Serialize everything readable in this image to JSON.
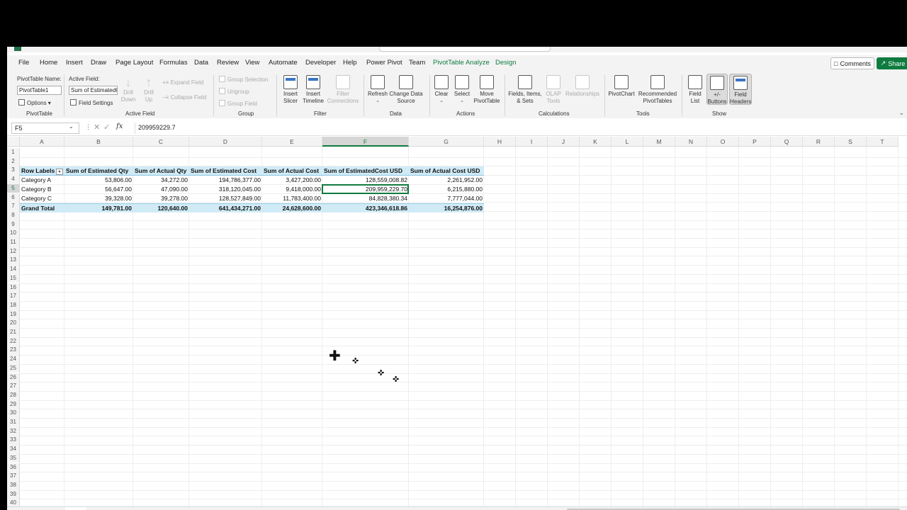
{
  "window": {
    "title_hint": ""
  },
  "tabs": [
    {
      "label": "File"
    },
    {
      "label": "Home"
    },
    {
      "label": "Insert"
    },
    {
      "label": "Draw"
    },
    {
      "label": "Page Layout"
    },
    {
      "label": "Formulas"
    },
    {
      "label": "Data"
    },
    {
      "label": "Review"
    },
    {
      "label": "View"
    },
    {
      "label": "Automate"
    },
    {
      "label": "Developer"
    },
    {
      "label": "Help"
    },
    {
      "label": "Power Pivot"
    },
    {
      "label": "Team"
    },
    {
      "label": "PivotTable Analyze"
    },
    {
      "label": "Design"
    }
  ],
  "active_tab": "PivotTable Analyze",
  "header_actions": {
    "comments": "Comments",
    "share": "Share"
  },
  "ribbon": {
    "pivottable": {
      "name_label": "PivotTable Name:",
      "name_value": "PivotTable1",
      "options": "Options",
      "group": "PivotTable"
    },
    "active_field": {
      "label": "Active Field:",
      "value": "Sum of EstimatedC",
      "field_settings": "Field Settings",
      "drill_down": "Drill Down",
      "drill_up": "Drill Up",
      "expand_field": "Expand Field",
      "collapse_field": "Collapse Field",
      "group": "Active Field"
    },
    "grouping": {
      "group_selection": "Group Selection",
      "ungroup": "Ungroup",
      "group_field": "Group Field",
      "group": "Group"
    },
    "filter": {
      "insert_slicer": "Insert Slicer",
      "insert_timeline": "Insert Timeline",
      "filter_connections": "Filter Connections",
      "group": "Filter"
    },
    "data": {
      "refresh": "Refresh",
      "change_source": "Change Data Source",
      "group": "Data"
    },
    "actions": {
      "clear": "Clear",
      "select": "Select",
      "move": "Move PivotTable",
      "group": "Actions"
    },
    "calculations": {
      "fields_items": "Fields, Items, & Sets",
      "olap": "OLAP Tools",
      "relationships": "Relationships",
      "group": "Calculations"
    },
    "tools": {
      "pivotchart": "PivotChart",
      "recommended": "Recommended PivotTables",
      "group": "Tools"
    },
    "show": {
      "field_list": "Field List",
      "buttons": "+/- Buttons",
      "field_headers": "Field Headers",
      "group": "Show"
    }
  },
  "formula_bar": {
    "name_box": "F5",
    "value": "209959229.7"
  },
  "columns": [
    "A",
    "B",
    "C",
    "D",
    "E",
    "F",
    "G",
    "H",
    "I",
    "J",
    "K",
    "L",
    "M",
    "N",
    "O",
    "P",
    "Q",
    "R",
    "S",
    "T"
  ],
  "rows": [
    "1",
    "2",
    "3",
    "4",
    "5",
    "6",
    "7",
    "8",
    "9",
    "10",
    "11",
    "12",
    "13",
    "14",
    "15",
    "16",
    "17",
    "18",
    "19",
    "20",
    "21",
    "22",
    "23",
    "24",
    "25",
    "26",
    "27",
    "28",
    "29",
    "30",
    "31",
    "32",
    "33",
    "34",
    "35",
    "36",
    "37",
    "38",
    "39",
    "40"
  ],
  "pivot": {
    "headers": [
      "Row Labels",
      "Sum of Estimated Qty",
      "Sum of Actual Qty",
      "Sum of Estimated Cost",
      "Sum of Actual Cost",
      "Sum of EstimatedCost USD",
      "Sum of Actual Cost USD"
    ],
    "rows": [
      [
        "Category A",
        "53,806.00",
        "34,272.00",
        "194,786,377.00",
        "3,427,200.00",
        "128,559,008.82",
        "2,261,952.00"
      ],
      [
        "Category B",
        "56,647.00",
        "47,090.00",
        "318,120,045.00",
        "9,418,000.00",
        "209,959,229.70",
        "6,215,880.00"
      ],
      [
        "Category C",
        "39,328.00",
        "39,278.00",
        "128,527,849.00",
        "11,783,400.00",
        "84,828,380.34",
        "7,777,044.00"
      ]
    ],
    "total": [
      "Grand Total",
      "149,781.00",
      "120,640.00",
      "641,434,271.00",
      "24,628,600.00",
      "423,346,618.86",
      "16,254,876.00"
    ]
  },
  "selected_cell": "F5",
  "icons": {
    "collapse_ribbon": "chevron-down-icon",
    "cursor": "move-cursor-icon"
  }
}
